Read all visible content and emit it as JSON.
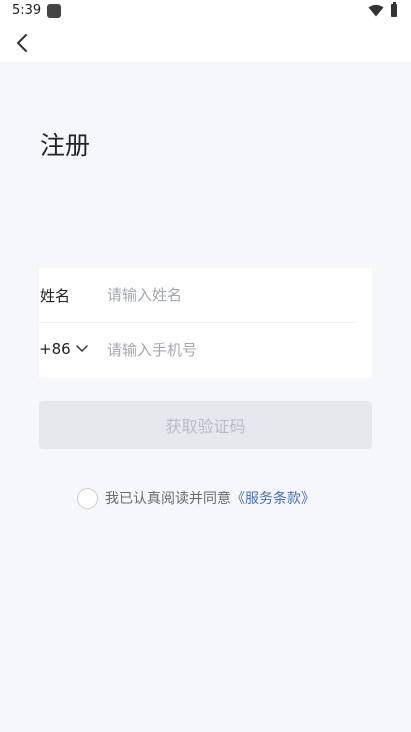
{
  "status_bar": {
    "time": "5:39"
  },
  "header": {
    "title": "注册"
  },
  "form": {
    "name_label": "姓名",
    "name_placeholder": "请输入姓名",
    "name_value": "",
    "country_code": "+86",
    "phone_placeholder": "请输入手机号",
    "phone_value": ""
  },
  "actions": {
    "get_code_label": "获取验证码"
  },
  "agreement": {
    "text": "我已认真阅读并同意",
    "terms_link": "《服务条款》",
    "checked": false
  },
  "icons": {
    "back": "chevron-left-icon",
    "country_dropdown": "chevron-down-icon",
    "wifi": "wifi-icon",
    "battery": "battery-icon"
  },
  "colors": {
    "background": "#f6f7fb",
    "card": "#ffffff",
    "button_disabled_bg": "#e6e8ee",
    "button_disabled_text": "#b9bdc6",
    "link": "#4a70b5"
  }
}
